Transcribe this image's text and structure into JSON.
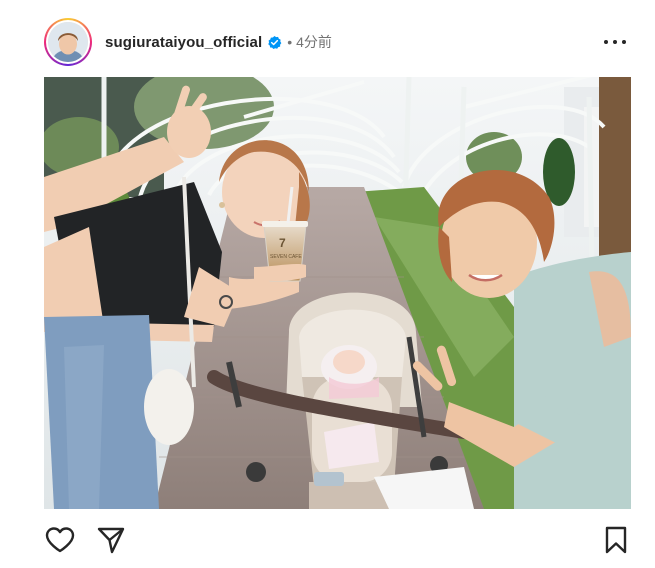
{
  "post": {
    "username": "sugiurataiyou_official",
    "separator": "•",
    "timestamp": "4分前",
    "verified": true
  },
  "icons": {
    "avatar": "profile-avatar",
    "verified": "verified-badge-icon",
    "more": "more-options-icon",
    "like": "heart-icon",
    "share": "paper-plane-icon",
    "save": "bookmark-icon"
  },
  "colors": {
    "verified_badge": "#0095f6",
    "text_primary": "#262626",
    "text_secondary": "#737373"
  },
  "photo": {
    "cup_logo": "7",
    "cup_text": "SEVEN CAFE"
  }
}
